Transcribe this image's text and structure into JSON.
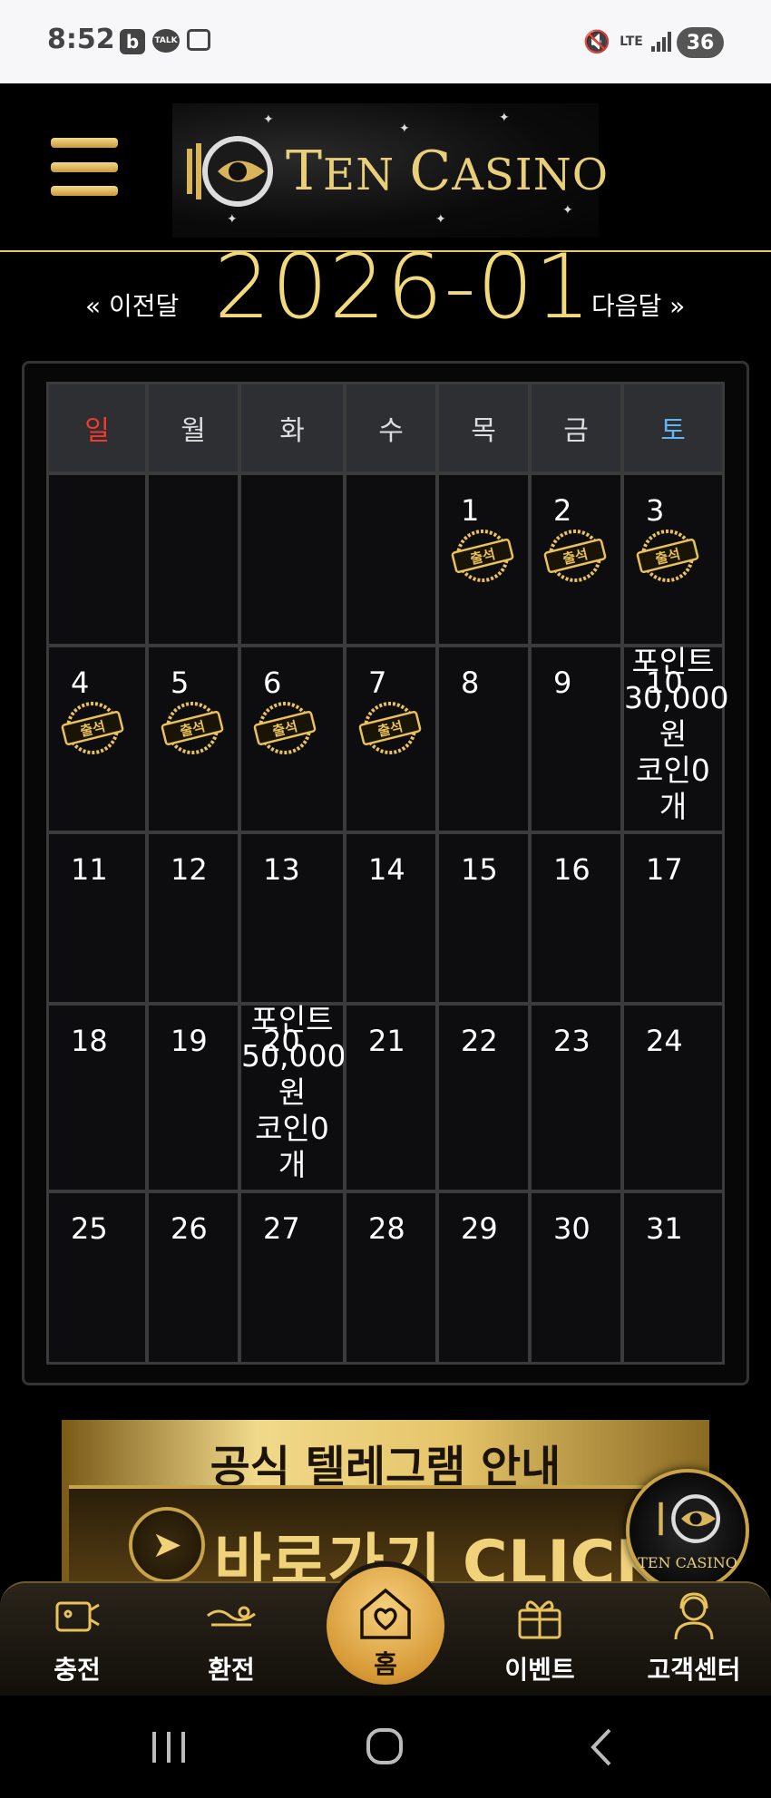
{
  "status_bar": {
    "time": "8:52",
    "talk_label": "TALK",
    "lte_label": "LTE",
    "battery": "36"
  },
  "header": {
    "logo_text_1": "T",
    "logo_text_2": "EN ",
    "logo_text_3": "C",
    "logo_text_4": "ASINO"
  },
  "month_nav": {
    "prev": "« 이전달",
    "title": "2026-01",
    "next": "다음달 »"
  },
  "calendar": {
    "weekdays": [
      "일",
      "월",
      "화",
      "수",
      "목",
      "금",
      "토"
    ],
    "weeks": [
      [
        null,
        null,
        null,
        null,
        1,
        2,
        3
      ],
      [
        4,
        5,
        6,
        7,
        8,
        9,
        10
      ],
      [
        11,
        12,
        13,
        14,
        15,
        16,
        17
      ],
      [
        18,
        19,
        20,
        21,
        22,
        23,
        24
      ],
      [
        25,
        26,
        27,
        28,
        29,
        30,
        31
      ]
    ],
    "attendance_days": [
      1,
      2,
      3,
      4,
      5,
      6,
      7
    ],
    "stamp_label": "출석",
    "rewards": {
      "10": {
        "line1": "포인트",
        "line2": "30,000",
        "line3": "원",
        "line4": "코인0",
        "line5": "개"
      },
      "20": {
        "line1": "포인트",
        "line2": "50,000",
        "line3": "원",
        "line4": "코인0",
        "line5": "개"
      }
    },
    "colors": {
      "sunday": "#f03a2e",
      "saturday": "#60b4f0",
      "gold": "#e9c25a"
    }
  },
  "banner": {
    "title": "공식 텔레그램 안내",
    "cta": "바로가기 CLICK"
  },
  "float_logo": {
    "text": "TEN CASINO"
  },
  "bottom_nav": {
    "items": [
      {
        "label": "충전",
        "icon": "deposit-icon"
      },
      {
        "label": "환전",
        "icon": "withdraw-icon"
      },
      {
        "label": "홈",
        "icon": "home-heart-icon"
      },
      {
        "label": "이벤트",
        "icon": "gift-icon"
      },
      {
        "label": "고객센터",
        "icon": "support-icon"
      }
    ]
  }
}
